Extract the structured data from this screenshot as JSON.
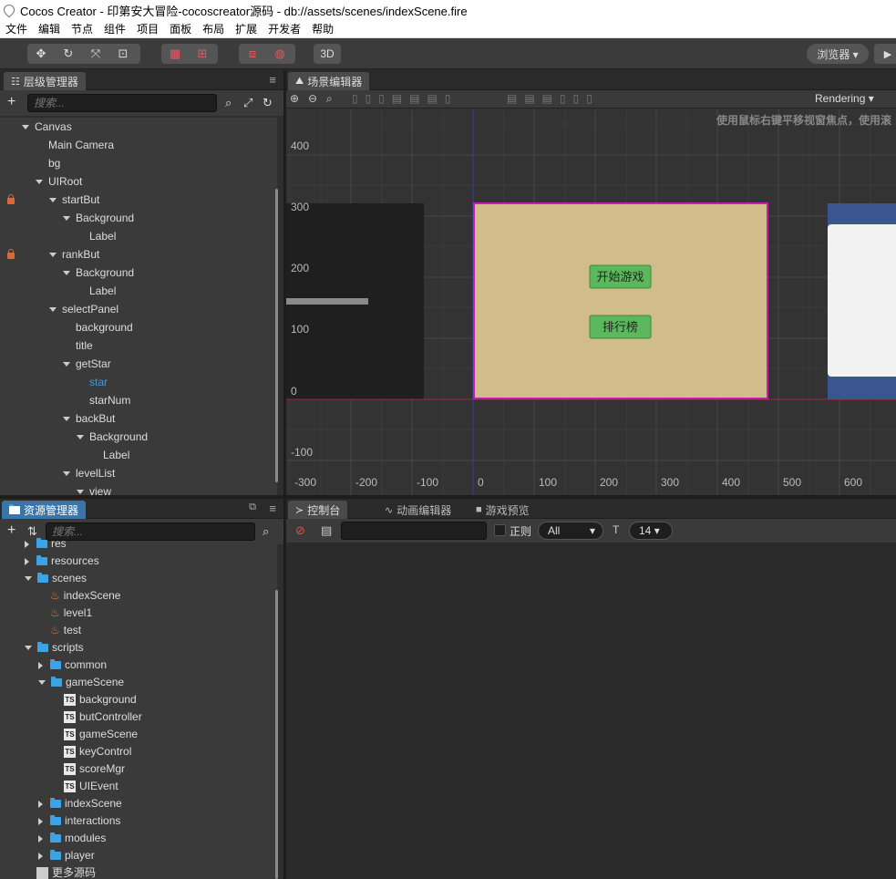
{
  "window": {
    "title": "Cocos Creator - 印第安大冒险-cocoscreator源码 - db://assets/scenes/indexScene.fire"
  },
  "menu": [
    "文件",
    "编辑",
    "节点",
    "组件",
    "项目",
    "面板",
    "布局",
    "扩展",
    "开发者",
    "帮助"
  ],
  "toolbar": {
    "btn_3d": "3D",
    "browser": "浏览器 ▾",
    "play_icon": "▶"
  },
  "hierarchy": {
    "tab": "层级管理器",
    "search_placeholder": "搜索...",
    "nodes": [
      {
        "label": "Canvas",
        "depth": 0,
        "arrow": "down",
        "lock": false,
        "selected": false
      },
      {
        "label": "Main Camera",
        "depth": 1,
        "arrow": "none",
        "lock": false,
        "selected": false
      },
      {
        "label": "bg",
        "depth": 1,
        "arrow": "none",
        "lock": false,
        "selected": false
      },
      {
        "label": "UIRoot",
        "depth": 1,
        "arrow": "down",
        "lock": false,
        "selected": false
      },
      {
        "label": "startBut",
        "depth": 2,
        "arrow": "down",
        "lock": true,
        "selected": false
      },
      {
        "label": "Background",
        "depth": 3,
        "arrow": "down",
        "lock": false,
        "selected": false
      },
      {
        "label": "Label",
        "depth": 4,
        "arrow": "none",
        "lock": false,
        "selected": false
      },
      {
        "label": "rankBut",
        "depth": 2,
        "arrow": "down",
        "lock": true,
        "selected": false
      },
      {
        "label": "Background",
        "depth": 3,
        "arrow": "down",
        "lock": false,
        "selected": false
      },
      {
        "label": "Label",
        "depth": 4,
        "arrow": "none",
        "lock": false,
        "selected": false
      },
      {
        "label": "selectPanel",
        "depth": 2,
        "arrow": "down",
        "lock": false,
        "selected": false
      },
      {
        "label": "background",
        "depth": 3,
        "arrow": "none",
        "lock": false,
        "selected": false
      },
      {
        "label": "title",
        "depth": 3,
        "arrow": "none",
        "lock": false,
        "selected": false
      },
      {
        "label": "getStar",
        "depth": 3,
        "arrow": "down",
        "lock": false,
        "selected": false
      },
      {
        "label": "star",
        "depth": 4,
        "arrow": "none",
        "lock": false,
        "selected": true
      },
      {
        "label": "starNum",
        "depth": 4,
        "arrow": "none",
        "lock": false,
        "selected": false
      },
      {
        "label": "backBut",
        "depth": 3,
        "arrow": "down",
        "lock": false,
        "selected": false
      },
      {
        "label": "Background",
        "depth": 4,
        "arrow": "down",
        "lock": false,
        "selected": false
      },
      {
        "label": "Label",
        "depth": 5,
        "arrow": "none",
        "lock": false,
        "selected": false
      },
      {
        "label": "levelList",
        "depth": 3,
        "arrow": "down",
        "lock": false,
        "selected": false
      },
      {
        "label": "view",
        "depth": 4,
        "arrow": "down",
        "lock": false,
        "selected": false
      }
    ]
  },
  "scene": {
    "tab": "场景编辑器",
    "rendering": "Rendering",
    "hint": "使用鼠标右键平移视窗焦点，使用滚",
    "y_ticks": [
      "400",
      "300",
      "200",
      "100",
      "0",
      "-100"
    ],
    "x_ticks": [
      "-300",
      "-200",
      "-100",
      "0",
      "100",
      "200",
      "300",
      "400",
      "500",
      "600"
    ],
    "buttons": {
      "start": "开始游戏",
      "rank": "排行榜"
    }
  },
  "assets": {
    "tab": "资源管理器",
    "search_placeholder": "搜索...",
    "items": [
      {
        "label": "res",
        "depth": 1,
        "kind": "folder",
        "arrow": "right"
      },
      {
        "label": "resources",
        "depth": 1,
        "kind": "folder",
        "arrow": "right"
      },
      {
        "label": "scenes",
        "depth": 1,
        "kind": "folder",
        "arrow": "down"
      },
      {
        "label": "indexScene",
        "depth": 2,
        "kind": "fire",
        "arrow": "none"
      },
      {
        "label": "level1",
        "depth": 2,
        "kind": "fire",
        "arrow": "none"
      },
      {
        "label": "test",
        "depth": 2,
        "kind": "fire",
        "arrow": "none"
      },
      {
        "label": "scripts",
        "depth": 1,
        "kind": "folder",
        "arrow": "down"
      },
      {
        "label": "common",
        "depth": 2,
        "kind": "folder",
        "arrow": "right"
      },
      {
        "label": "gameScene",
        "depth": 2,
        "kind": "folder",
        "arrow": "down"
      },
      {
        "label": "background",
        "depth": 3,
        "kind": "ts",
        "arrow": "none"
      },
      {
        "label": "butController",
        "depth": 3,
        "kind": "ts",
        "arrow": "none"
      },
      {
        "label": "gameScene",
        "depth": 3,
        "kind": "ts",
        "arrow": "none"
      },
      {
        "label": "keyControl",
        "depth": 3,
        "kind": "ts",
        "arrow": "none"
      },
      {
        "label": "scoreMgr",
        "depth": 3,
        "kind": "ts",
        "arrow": "none"
      },
      {
        "label": "UIEvent",
        "depth": 3,
        "kind": "ts",
        "arrow": "none"
      },
      {
        "label": "indexScene",
        "depth": 2,
        "kind": "folder",
        "arrow": "right"
      },
      {
        "label": "interactions",
        "depth": 2,
        "kind": "folder",
        "arrow": "right"
      },
      {
        "label": "modules",
        "depth": 2,
        "kind": "folder",
        "arrow": "right"
      },
      {
        "label": "player",
        "depth": 2,
        "kind": "folder",
        "arrow": "right"
      },
      {
        "label": "更多源码",
        "depth": 0,
        "kind": "doc",
        "arrow": "none"
      }
    ]
  },
  "console": {
    "tabs": [
      "控制台",
      "动画编辑器",
      "游戏预览"
    ],
    "regex_label": "正则",
    "level": "All",
    "font_size": "14",
    "ts_badge": "TS"
  },
  "colors": {
    "selection": "#3a9de8",
    "scene_panel": "#d1bd8b",
    "scene_border": "#c21fb5",
    "button_green": "#5cb85c"
  }
}
